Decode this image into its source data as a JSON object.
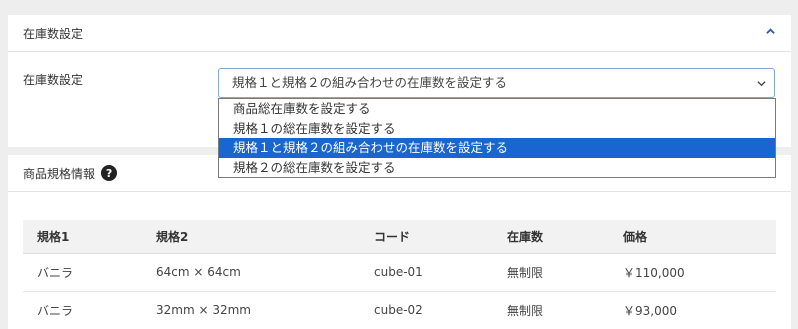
{
  "stock_section": {
    "title": "在庫数設定",
    "field_label": "在庫数設定",
    "select_value": "規格１と規格２の組み合わせの在庫数を設定する",
    "options": [
      "商品総在庫数を設定する",
      "規格１の総在庫数を設定する",
      "規格１と規格２の組み合わせの在庫数を設定する",
      "規格２の総在庫数を設定する"
    ],
    "selected_index": 2
  },
  "spec_section": {
    "title": "商品規格情報",
    "help_glyph": "?",
    "columns": [
      "規格1",
      "規格2",
      "コード",
      "在庫数",
      "価格"
    ],
    "rows": [
      [
        "バニラ",
        "64cm × 64cm",
        "cube-01",
        "無制限",
        "￥110,000"
      ],
      [
        "バニラ",
        "32mm × 32mm",
        "cube-02",
        "無制限",
        "￥93,000"
      ]
    ]
  },
  "colors": {
    "accent": "#1a66d0",
    "chevron": "#2a5fa8"
  },
  "icons": {
    "collapse": "chevron-up-icon",
    "select_caret": "chevron-down-icon",
    "help": "question-circle-icon"
  }
}
